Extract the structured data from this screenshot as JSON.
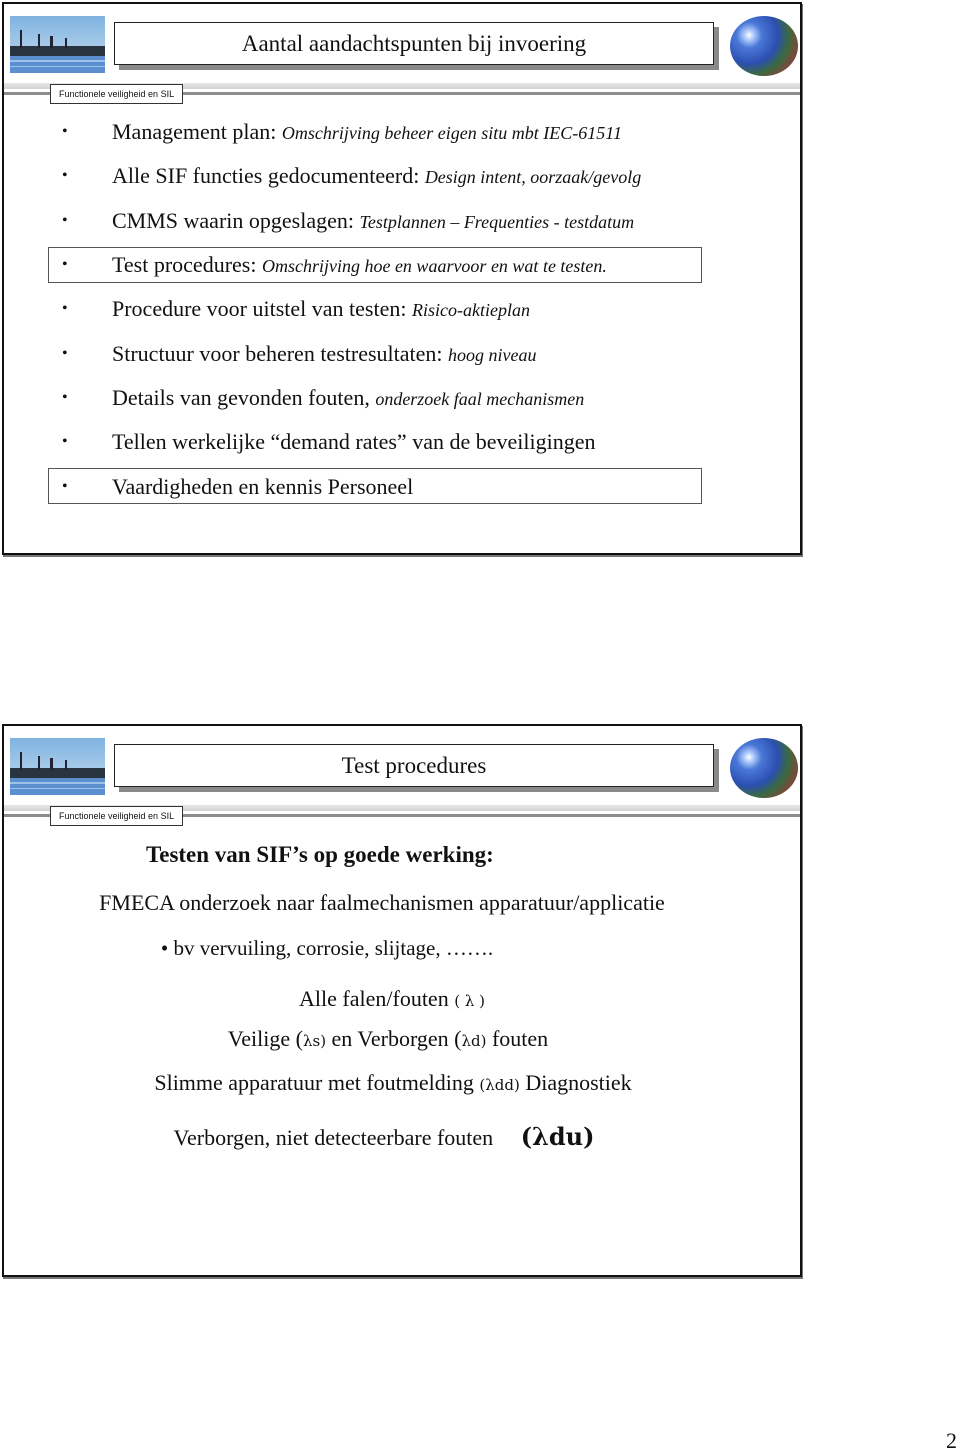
{
  "slides": [
    {
      "title": "Aantal aandachtspunten bij invoering",
      "tag": "Functionele veiligheid en SIL",
      "bullets": [
        {
          "bullet": "•",
          "main": "Management plan: ",
          "sub": "Omschrijving beheer eigen situ mbt IEC-61511",
          "boxed": false
        },
        {
          "bullet": "•",
          "main": "Alle SIF functies gedocumenteerd: ",
          "sub": "Design intent, oorzaak/gevolg",
          "boxed": false
        },
        {
          "bullet": "•",
          "main": "CMMS waarin opgeslagen: ",
          "sub": "Testplannen – Frequenties - testdatum",
          "boxed": false
        },
        {
          "bullet": "•",
          "main": "Test procedures: ",
          "sub": "Omschrijving hoe en waarvoor en wat te testen.",
          "boxed": true
        },
        {
          "bullet": "•",
          "main": "Procedure voor uitstel van testen: ",
          "sub": "Risico-aktieplan",
          "boxed": false
        },
        {
          "bullet": "•",
          "main": "Structuur voor beheren testresultaten: ",
          "sub": "hoog niveau",
          "boxed": false
        },
        {
          "bullet": "•",
          "main": "Details van gevonden fouten,  ",
          "sub": "onderzoek faal mechanismen",
          "boxed": false
        },
        {
          "bullet": "•",
          "main": "Tellen werkelijke “demand rates” van de beveiligingen",
          "sub": "",
          "boxed": false
        },
        {
          "bullet": "•",
          "main": "Vaardigheden en kennis Personeel",
          "sub": "",
          "boxed": true
        }
      ]
    },
    {
      "title": "Test procedures",
      "tag": "Functionele veiligheid en SIL",
      "heading": "Testen van SIF’s op goede werking:",
      "fmeca": "FMECA onderzoek naar faalmechanismen apparatuur/applicatie",
      "example": "• bv vervuiling, corrosie, slijtage, …….",
      "all_faults": {
        "text": "Alle falen/fouten ",
        "sym": "( λ )"
      },
      "safe_hidden": {
        "a": "Veilige (",
        "l1": "λs)",
        "b": " en Verborgen (",
        "l2": "λd)",
        "c": " fouten"
      },
      "smart": {
        "a": "Slimme apparatuur met foutmelding ",
        "l": "(λdd)",
        "b": " Diagnostiek"
      },
      "undetectable": {
        "a": "Verborgen, niet detecteerbare fouten",
        "l": "(λdu)"
      }
    }
  ],
  "page_number_fragment": "2"
}
